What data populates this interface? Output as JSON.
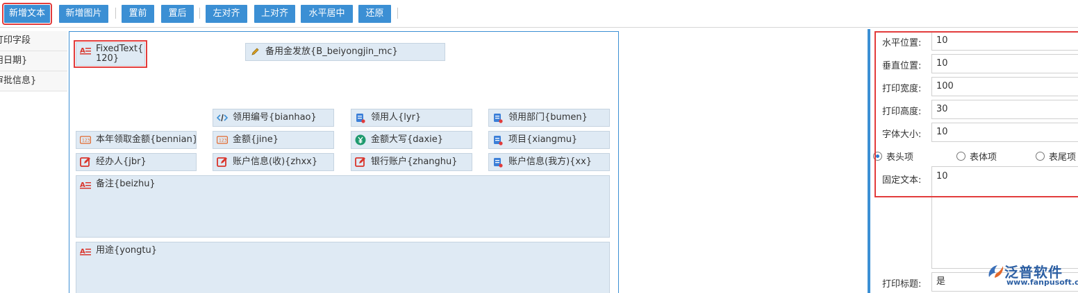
{
  "toolbar": {
    "buttons": [
      "新增文本",
      "新增图片",
      "置前",
      "置后",
      "左对齐",
      "上对齐",
      "水平居中",
      "还原"
    ]
  },
  "left_list": {
    "items": [
      "打印字段",
      "用日期}",
      "审批信息}"
    ]
  },
  "canvas": {
    "fixed_text": "FixedText{ 120}",
    "reserve": "备用金发放{B_beiyongjin_mc}",
    "row1": [
      "领用编号{bianhao}",
      "领用人{lyr}",
      "领用部门{bumen}"
    ],
    "row2": [
      "本年领取金额{bennian}",
      "金额{jine}",
      "金额大写{daxie}",
      "项目{xiangmu}"
    ],
    "row3": [
      "经办人{jbr}",
      "账户信息(收){zhxx}",
      "银行账户{zhanghu}",
      "账户信息(我方){xx}"
    ],
    "beizhu": "备注{beizhu}",
    "yongtu": "用途{yongtu}"
  },
  "properties": {
    "horizontal_label": "水平位置:",
    "horizontal_value": "10",
    "vertical_label": "垂直位置:",
    "vertical_value": "10",
    "width_label": "打印宽度:",
    "width_value": "100",
    "height_label": "打印高度:",
    "height_value": "30",
    "fontsize_label": "字体大小:",
    "fontsize_value": "10",
    "radio_header": "表头项",
    "radio_body": "表体项",
    "radio_footer": "表尾项",
    "fixed_text_label": "固定文本:",
    "fixed_text_value": "10",
    "print_title_label": "打印标题:",
    "print_title_value": "是"
  },
  "logo": {
    "name": "泛普软件",
    "url": "www.fanpusoft.com"
  },
  "colors": {
    "accent": "#3b8fd4",
    "highlight": "#e23b3b",
    "field_bg": "#dfeaf4"
  }
}
